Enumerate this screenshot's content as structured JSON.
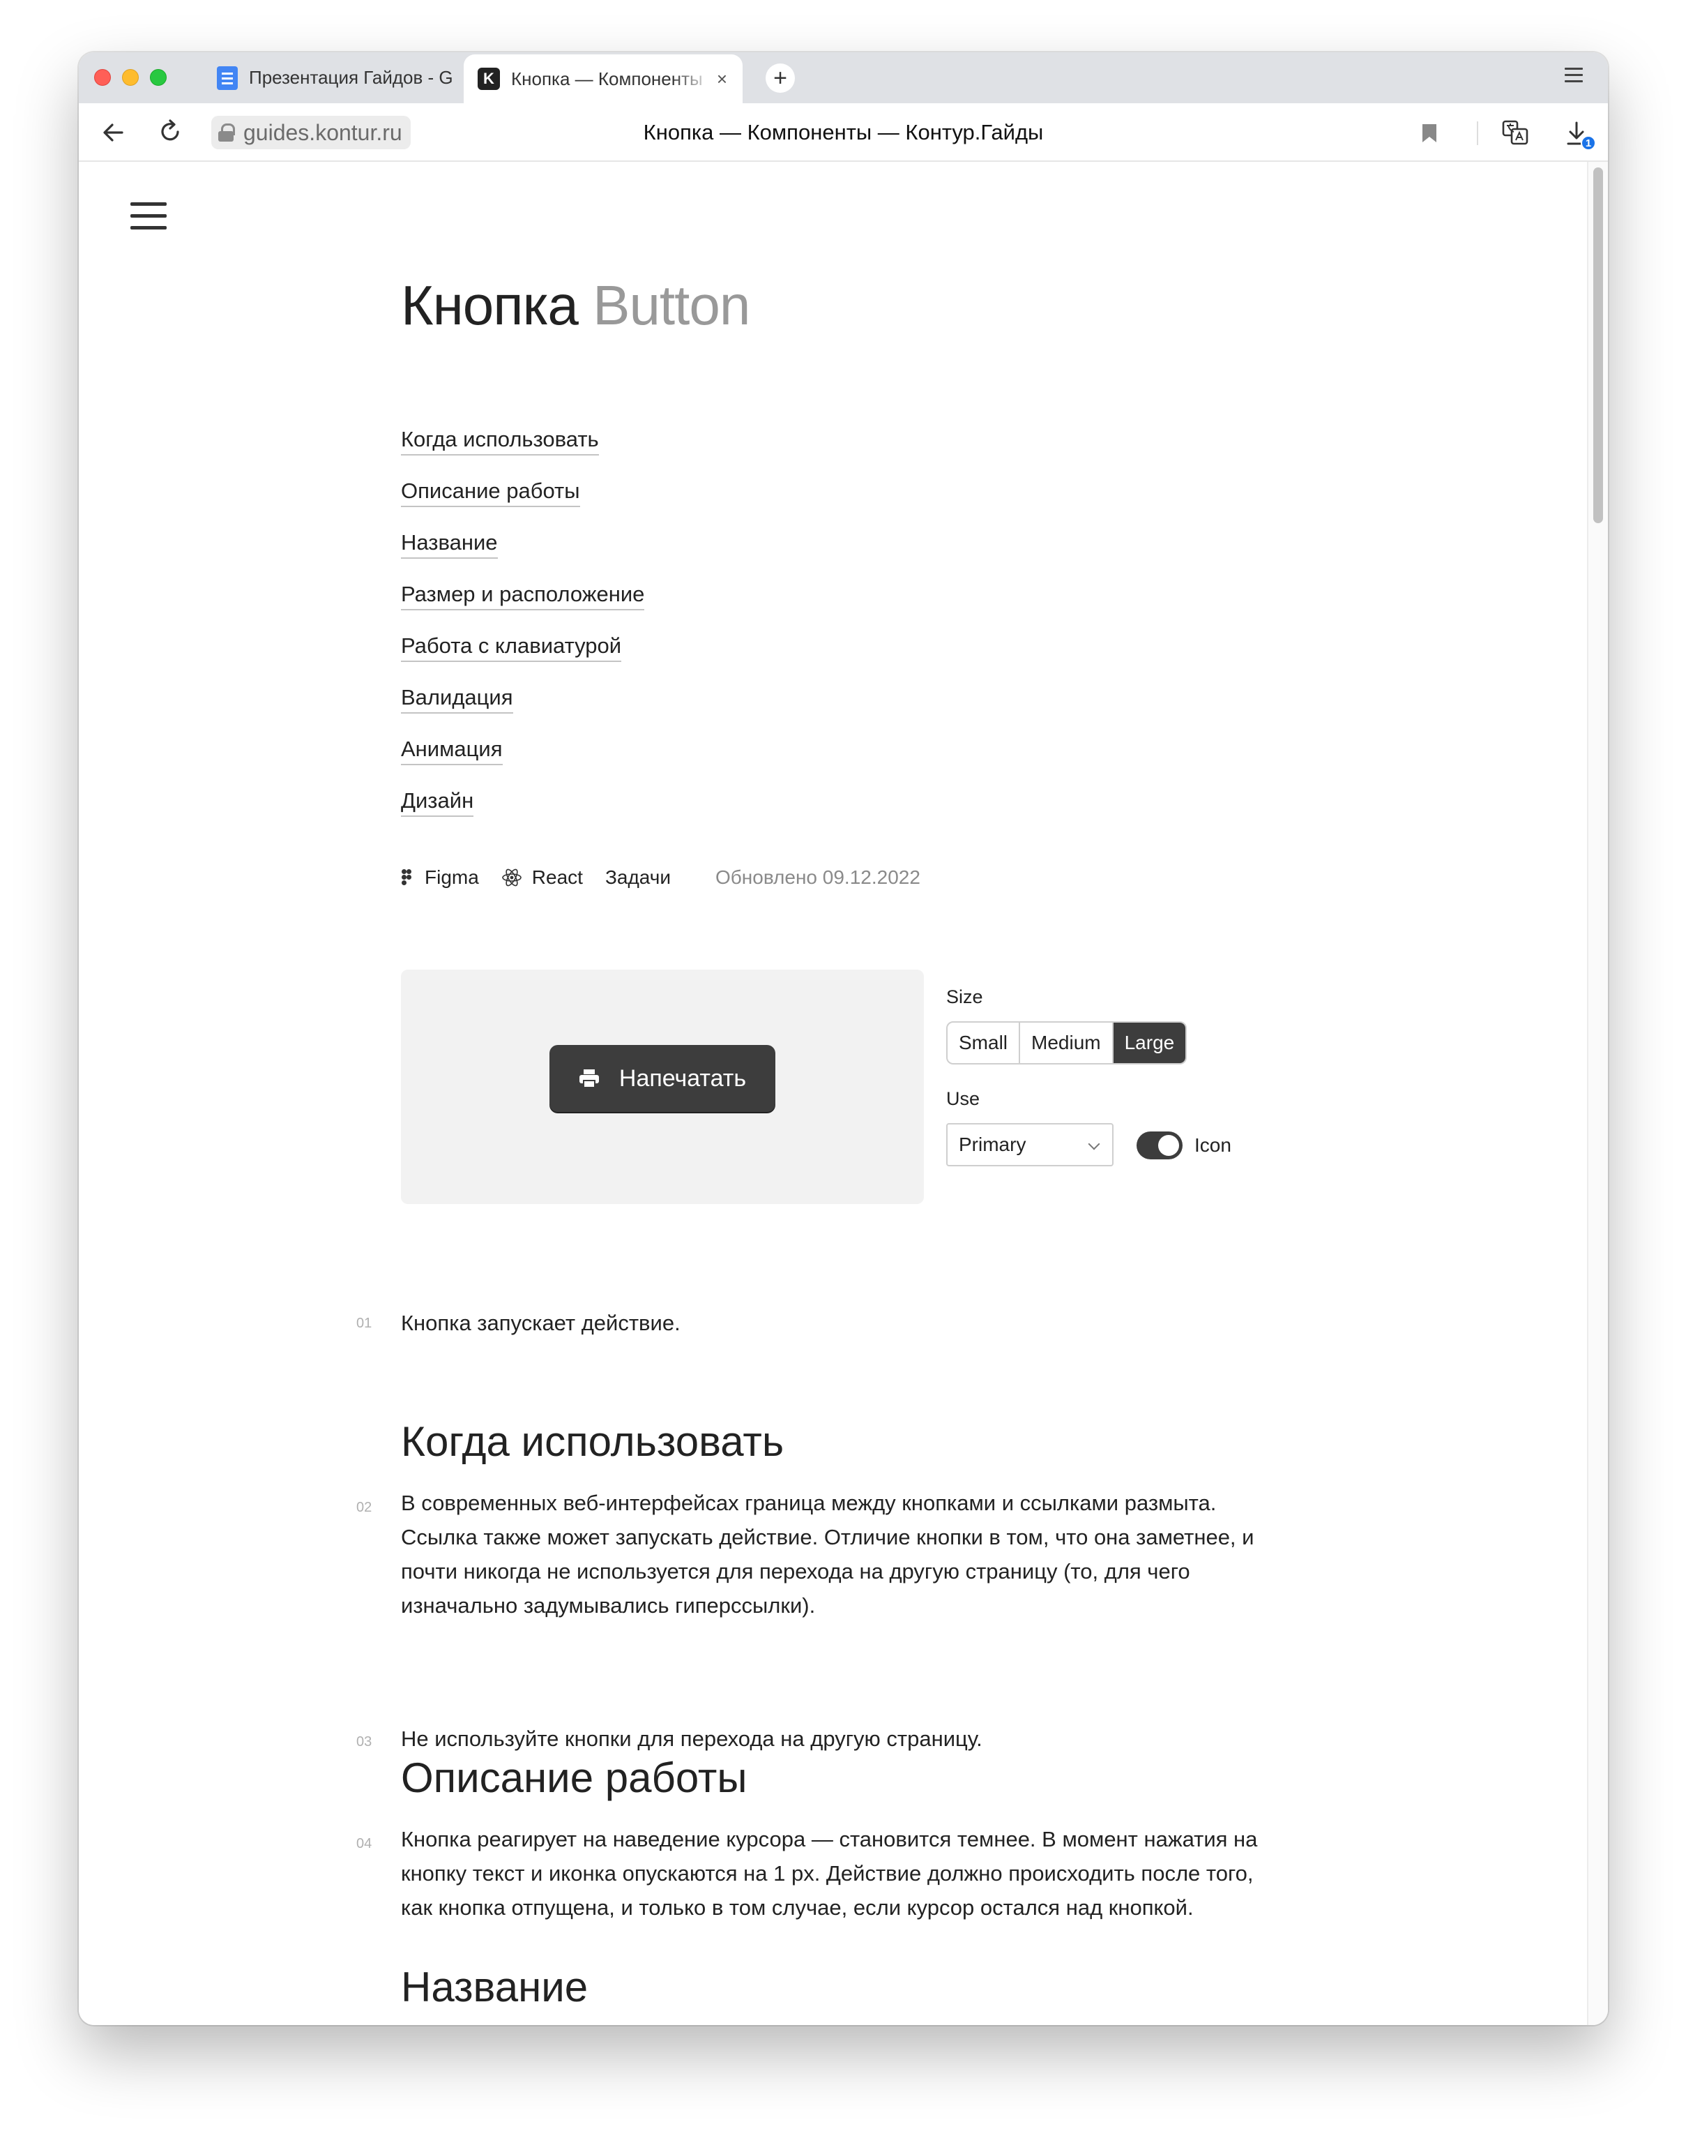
{
  "browser": {
    "tabs": [
      {
        "title": "Презентация Гайдов - G",
        "icon": "google-docs-icon"
      },
      {
        "title": "Кнопка — Компоненты",
        "icon": "kontur-k-icon",
        "active": true
      }
    ],
    "tab_close": "×",
    "new_tab": "+",
    "url": "guides.kontur.ru",
    "page_title": "Кнопка — Компоненты — Контур.Гайды",
    "download_badge": "1"
  },
  "page": {
    "title_ru": "Кнопка",
    "title_en": "Button",
    "toc": [
      "Когда использовать",
      "Описание работы",
      "Название",
      "Размер и расположение",
      "Работа с клавиатурой",
      "Валидация",
      "Анимация",
      "Дизайн"
    ],
    "links": {
      "figma": "Figma",
      "react": "React",
      "tasks": "Задачи",
      "updated": "Обновлено 09.12.2022"
    },
    "demo": {
      "button_label": "Напечатать",
      "size_label": "Size",
      "sizes": [
        "Small",
        "Medium",
        "Large"
      ],
      "size_selected": "Large",
      "use_label": "Use",
      "use_value": "Primary",
      "icon_toggle_label": "Icon",
      "icon_toggle_on": true
    },
    "sections": {
      "p01_num": "01",
      "p01": "Кнопка запускает действие.",
      "h_when": "Когда использовать",
      "p02_num": "02",
      "p02": "В современных веб-интерфейсах граница между кнопками и ссылками размыта. Ссылка также может запускать действие. Отличие кнопки в том, что она заметнее, и почти никогда не используется для перехода на другую страницу (то, для чего изначально задумывались гиперссылки).",
      "p03_num": "03",
      "p03": "Не используйте кнопки для перехода на другую страницу.",
      "h_desc": "Описание работы",
      "p04_num": "04",
      "p04": "Кнопка реагирует на наведение курсора — становится темнее. В момент нажатия на кнопку текст и иконка опускаются на 1 px. Действие должно происходить после того, как кнопка отпущена, и только в том случае, если курсор остался над кнопкой.",
      "h_name": "Название"
    }
  }
}
